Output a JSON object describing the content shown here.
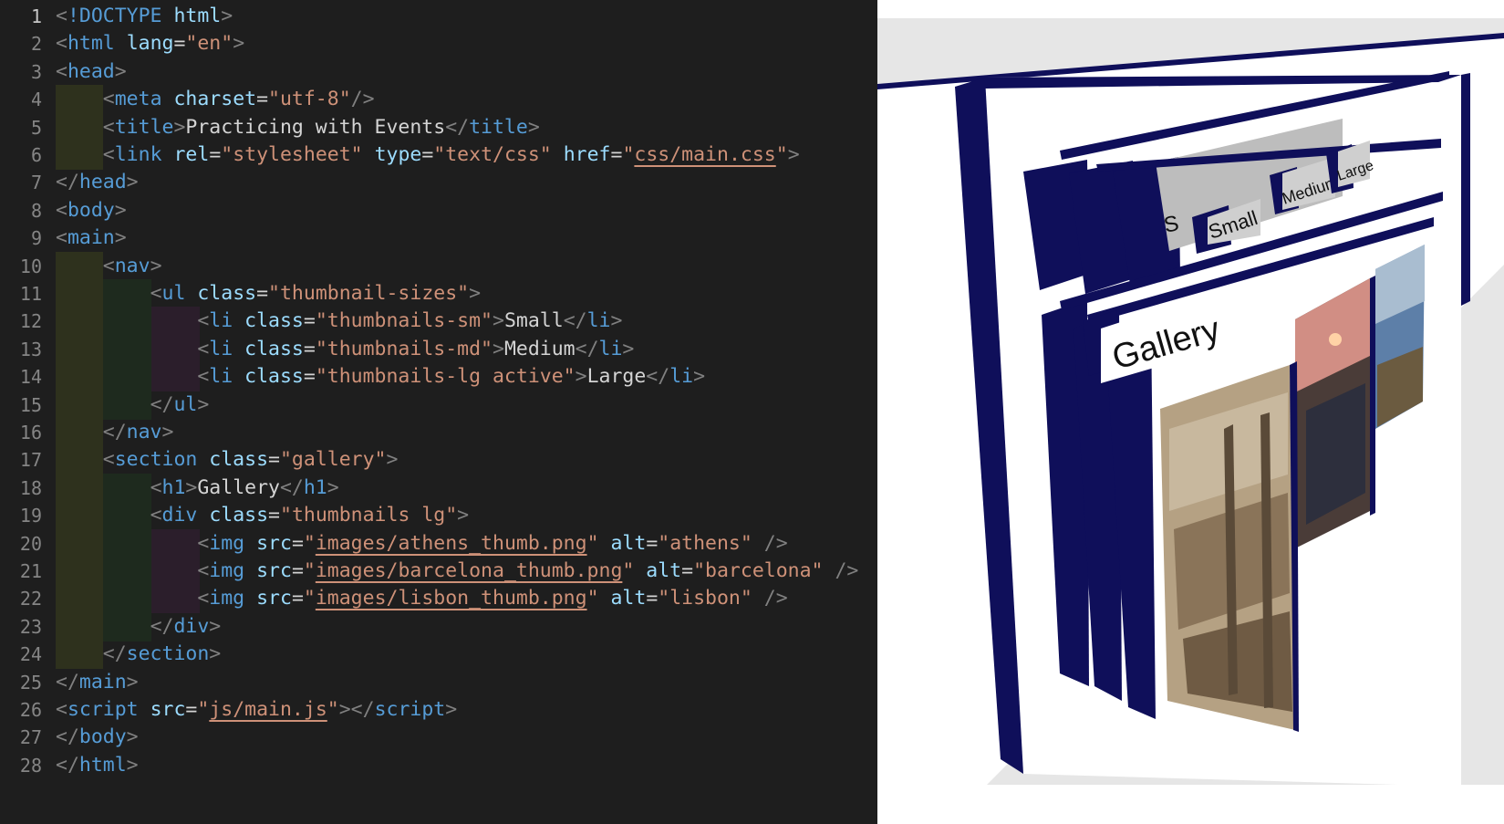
{
  "editor": {
    "lines": [
      {
        "n": "1",
        "tokens": [
          [
            "p",
            "<"
          ],
          [
            "t",
            "!DOCTYPE"
          ],
          [
            "x",
            " "
          ],
          [
            "a",
            "html"
          ],
          [
            "p",
            ">"
          ]
        ]
      },
      {
        "n": "2",
        "tokens": [
          [
            "p",
            "<"
          ],
          [
            "t",
            "html"
          ],
          [
            "x",
            " "
          ],
          [
            "a",
            "lang"
          ],
          [
            "x",
            "="
          ],
          [
            "s",
            "\"en\""
          ],
          [
            "p",
            ">"
          ]
        ]
      },
      {
        "n": "3",
        "tokens": [
          [
            "p",
            "<"
          ],
          [
            "t",
            "head"
          ],
          [
            "p",
            ">"
          ]
        ]
      },
      {
        "n": "4",
        "tokens": [
          [
            "x",
            "    "
          ],
          [
            "p",
            "<"
          ],
          [
            "t",
            "meta"
          ],
          [
            "x",
            " "
          ],
          [
            "a",
            "charset"
          ],
          [
            "x",
            "="
          ],
          [
            "s",
            "\"utf-8\""
          ],
          [
            "p",
            "/>"
          ]
        ]
      },
      {
        "n": "5",
        "tokens": [
          [
            "x",
            "    "
          ],
          [
            "p",
            "<"
          ],
          [
            "t",
            "title"
          ],
          [
            "p",
            ">"
          ],
          [
            "x",
            "Practicing with Events"
          ],
          [
            "p",
            "</"
          ],
          [
            "t",
            "title"
          ],
          [
            "p",
            ">"
          ]
        ]
      },
      {
        "n": "6",
        "tokens": [
          [
            "x",
            "    "
          ],
          [
            "p",
            "<"
          ],
          [
            "t",
            "link"
          ],
          [
            "x",
            " "
          ],
          [
            "a",
            "rel"
          ],
          [
            "x",
            "="
          ],
          [
            "s",
            "\"stylesheet\""
          ],
          [
            "x",
            " "
          ],
          [
            "a",
            "type"
          ],
          [
            "x",
            "="
          ],
          [
            "s",
            "\"text/css\""
          ],
          [
            "x",
            " "
          ],
          [
            "a",
            "href"
          ],
          [
            "x",
            "="
          ],
          [
            "s",
            "\""
          ],
          [
            "u",
            "css/main.css"
          ],
          [
            "s",
            "\""
          ],
          [
            "p",
            ">"
          ]
        ]
      },
      {
        "n": "7",
        "tokens": [
          [
            "p",
            "</"
          ],
          [
            "t",
            "head"
          ],
          [
            "p",
            ">"
          ]
        ]
      },
      {
        "n": "8",
        "tokens": [
          [
            "p",
            "<"
          ],
          [
            "t",
            "body"
          ],
          [
            "p",
            ">"
          ]
        ]
      },
      {
        "n": "9",
        "tokens": [
          [
            "p",
            "<"
          ],
          [
            "t",
            "main"
          ],
          [
            "p",
            ">"
          ]
        ]
      },
      {
        "n": "10",
        "tokens": [
          [
            "x",
            "    "
          ],
          [
            "p",
            "<"
          ],
          [
            "t",
            "nav"
          ],
          [
            "p",
            ">"
          ]
        ]
      },
      {
        "n": "11",
        "tokens": [
          [
            "x",
            "        "
          ],
          [
            "p",
            "<"
          ],
          [
            "t",
            "ul"
          ],
          [
            "x",
            " "
          ],
          [
            "a",
            "class"
          ],
          [
            "x",
            "="
          ],
          [
            "s",
            "\"thumbnail-sizes\""
          ],
          [
            "p",
            ">"
          ]
        ]
      },
      {
        "n": "12",
        "tokens": [
          [
            "x",
            "            "
          ],
          [
            "p",
            "<"
          ],
          [
            "t",
            "li"
          ],
          [
            "x",
            " "
          ],
          [
            "a",
            "class"
          ],
          [
            "x",
            "="
          ],
          [
            "s",
            "\"thumbnails-sm\""
          ],
          [
            "p",
            ">"
          ],
          [
            "x",
            "Small"
          ],
          [
            "p",
            "</"
          ],
          [
            "t",
            "li"
          ],
          [
            "p",
            ">"
          ]
        ]
      },
      {
        "n": "13",
        "tokens": [
          [
            "x",
            "            "
          ],
          [
            "p",
            "<"
          ],
          [
            "t",
            "li"
          ],
          [
            "x",
            " "
          ],
          [
            "a",
            "class"
          ],
          [
            "x",
            "="
          ],
          [
            "s",
            "\"thumbnails-md\""
          ],
          [
            "p",
            ">"
          ],
          [
            "x",
            "Medium"
          ],
          [
            "p",
            "</"
          ],
          [
            "t",
            "li"
          ],
          [
            "p",
            ">"
          ]
        ]
      },
      {
        "n": "14",
        "tokens": [
          [
            "x",
            "            "
          ],
          [
            "p",
            "<"
          ],
          [
            "t",
            "li"
          ],
          [
            "x",
            " "
          ],
          [
            "a",
            "class"
          ],
          [
            "x",
            "="
          ],
          [
            "s",
            "\"thumbnails-lg active\""
          ],
          [
            "p",
            ">"
          ],
          [
            "x",
            "Large"
          ],
          [
            "p",
            "</"
          ],
          [
            "t",
            "li"
          ],
          [
            "p",
            ">"
          ]
        ]
      },
      {
        "n": "15",
        "tokens": [
          [
            "x",
            "        "
          ],
          [
            "p",
            "</"
          ],
          [
            "t",
            "ul"
          ],
          [
            "p",
            ">"
          ]
        ]
      },
      {
        "n": "16",
        "tokens": [
          [
            "x",
            "    "
          ],
          [
            "p",
            "</"
          ],
          [
            "t",
            "nav"
          ],
          [
            "p",
            ">"
          ]
        ]
      },
      {
        "n": "17",
        "tokens": [
          [
            "x",
            "    "
          ],
          [
            "p",
            "<"
          ],
          [
            "t",
            "section"
          ],
          [
            "x",
            " "
          ],
          [
            "a",
            "class"
          ],
          [
            "x",
            "="
          ],
          [
            "s",
            "\"gallery\""
          ],
          [
            "p",
            ">"
          ]
        ]
      },
      {
        "n": "18",
        "tokens": [
          [
            "x",
            "        "
          ],
          [
            "p",
            "<"
          ],
          [
            "t",
            "h1"
          ],
          [
            "p",
            ">"
          ],
          [
            "x",
            "Gallery"
          ],
          [
            "p",
            "</"
          ],
          [
            "t",
            "h1"
          ],
          [
            "p",
            ">"
          ]
        ]
      },
      {
        "n": "19",
        "tokens": [
          [
            "x",
            "        "
          ],
          [
            "p",
            "<"
          ],
          [
            "t",
            "div"
          ],
          [
            "x",
            " "
          ],
          [
            "a",
            "class"
          ],
          [
            "x",
            "="
          ],
          [
            "s",
            "\"thumbnails lg\""
          ],
          [
            "p",
            ">"
          ]
        ]
      },
      {
        "n": "20",
        "tokens": [
          [
            "x",
            "            "
          ],
          [
            "p",
            "<"
          ],
          [
            "t",
            "img"
          ],
          [
            "x",
            " "
          ],
          [
            "a",
            "src"
          ],
          [
            "x",
            "="
          ],
          [
            "s",
            "\""
          ],
          [
            "u",
            "images/athens_thumb.png"
          ],
          [
            "s",
            "\""
          ],
          [
            "x",
            " "
          ],
          [
            "a",
            "alt"
          ],
          [
            "x",
            "="
          ],
          [
            "s",
            "\"athens\""
          ],
          [
            "x",
            " "
          ],
          [
            "p",
            "/>"
          ]
        ]
      },
      {
        "n": "21",
        "tokens": [
          [
            "x",
            "            "
          ],
          [
            "p",
            "<"
          ],
          [
            "t",
            "img"
          ],
          [
            "x",
            " "
          ],
          [
            "a",
            "src"
          ],
          [
            "x",
            "="
          ],
          [
            "s",
            "\""
          ],
          [
            "u",
            "images/barcelona_thumb.png"
          ],
          [
            "s",
            "\""
          ],
          [
            "x",
            " "
          ],
          [
            "a",
            "alt"
          ],
          [
            "x",
            "="
          ],
          [
            "s",
            "\"barcelona\""
          ],
          [
            "x",
            " "
          ],
          [
            "p",
            "/>"
          ]
        ]
      },
      {
        "n": "22",
        "tokens": [
          [
            "x",
            "            "
          ],
          [
            "p",
            "<"
          ],
          [
            "t",
            "img"
          ],
          [
            "x",
            " "
          ],
          [
            "a",
            "src"
          ],
          [
            "x",
            "="
          ],
          [
            "s",
            "\""
          ],
          [
            "u",
            "images/lisbon_thumb.png"
          ],
          [
            "s",
            "\""
          ],
          [
            "x",
            " "
          ],
          [
            "a",
            "alt"
          ],
          [
            "x",
            "="
          ],
          [
            "s",
            "\"lisbon\""
          ],
          [
            "x",
            " "
          ],
          [
            "p",
            "/>"
          ]
        ]
      },
      {
        "n": "23",
        "tokens": [
          [
            "x",
            "        "
          ],
          [
            "p",
            "</"
          ],
          [
            "t",
            "div"
          ],
          [
            "p",
            ">"
          ]
        ]
      },
      {
        "n": "24",
        "tokens": [
          [
            "x",
            "    "
          ],
          [
            "p",
            "</"
          ],
          [
            "t",
            "section"
          ],
          [
            "p",
            ">"
          ]
        ]
      },
      {
        "n": "25",
        "tokens": [
          [
            "p",
            "</"
          ],
          [
            "t",
            "main"
          ],
          [
            "p",
            ">"
          ]
        ]
      },
      {
        "n": "26",
        "tokens": [
          [
            "p",
            "<"
          ],
          [
            "t",
            "script"
          ],
          [
            "x",
            " "
          ],
          [
            "a",
            "src"
          ],
          [
            "x",
            "="
          ],
          [
            "s",
            "\""
          ],
          [
            "u",
            "js/main.js"
          ],
          [
            "s",
            "\""
          ],
          [
            "p",
            "></"
          ],
          [
            "t",
            "script"
          ],
          [
            "p",
            ">"
          ]
        ]
      },
      {
        "n": "27",
        "tokens": [
          [
            "p",
            "</"
          ],
          [
            "t",
            "body"
          ],
          [
            "p",
            ">"
          ]
        ]
      },
      {
        "n": "28",
        "tokens": [
          [
            "p",
            "</"
          ],
          [
            "t",
            "html"
          ],
          [
            "p",
            ">"
          ]
        ]
      }
    ],
    "guides": [
      [],
      [],
      [],
      [
        1
      ],
      [
        1
      ],
      [
        1
      ],
      [],
      [],
      [],
      [
        1
      ],
      [
        1,
        2
      ],
      [
        1,
        2,
        3
      ],
      [
        1,
        2,
        3
      ],
      [
        1,
        2,
        3
      ],
      [
        1,
        2
      ],
      [
        1
      ],
      [
        1
      ],
      [
        1,
        2
      ],
      [
        1,
        2
      ],
      [
        1,
        2,
        3
      ],
      [
        1,
        2,
        3
      ],
      [
        1,
        2,
        3
      ],
      [
        1,
        2
      ],
      [
        1
      ],
      [],
      [],
      [],
      []
    ],
    "current_line": 1
  },
  "viewer": {
    "size_labels": [
      "Small",
      "Medium",
      "Large"
    ],
    "heading": "Gallery",
    "cropped_size_label": "S",
    "colors": {
      "layer_edge": "#0f0f5a",
      "floor": "#e6e6e6",
      "nav_face": "#bdbdbd"
    }
  }
}
